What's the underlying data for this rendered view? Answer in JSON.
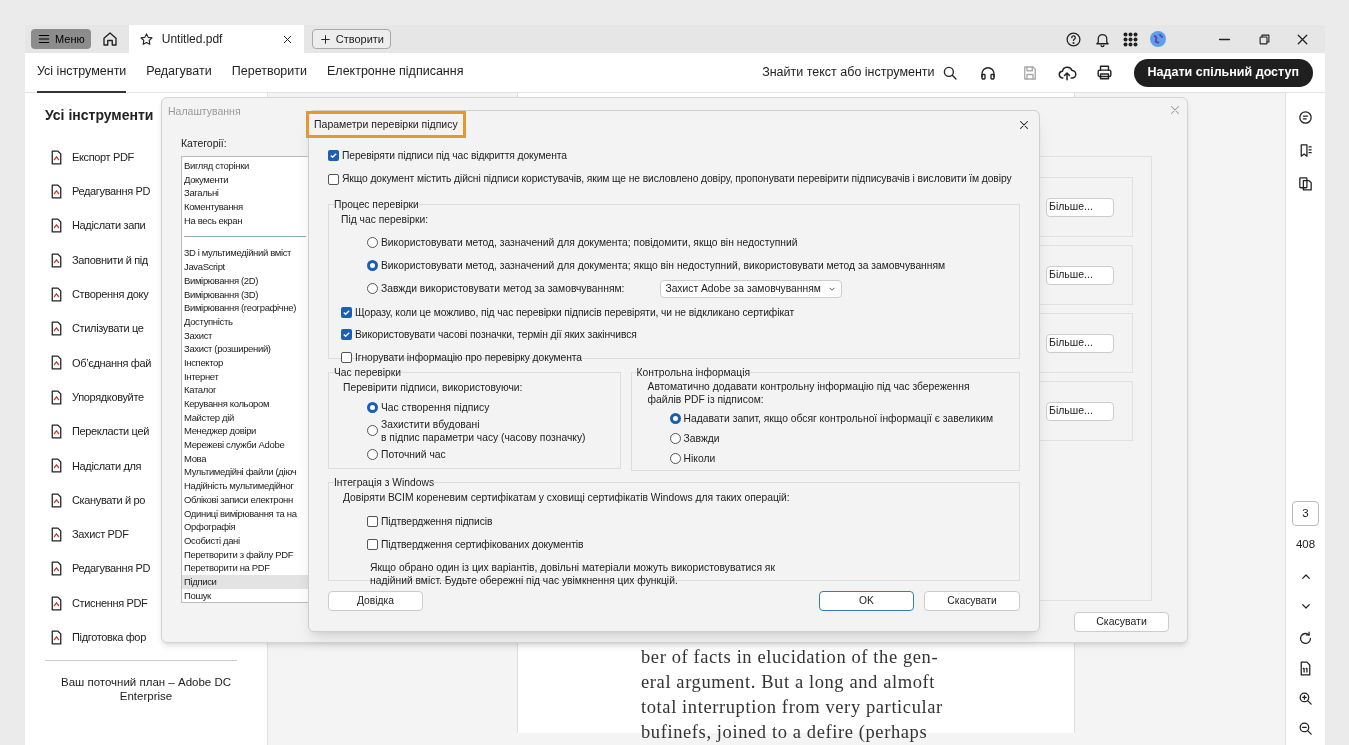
{
  "tab_bar": {
    "menu_button": "Меню",
    "tabs": [
      {
        "label": "Untitled.pdf",
        "selected": true
      }
    ],
    "new_button": "Створити"
  },
  "toolbar": {
    "tabs": [
      {
        "label": "Усі інструменти",
        "selected": true
      },
      {
        "label": "Редагувати",
        "selected": false
      },
      {
        "label": "Перетворити",
        "selected": false
      },
      {
        "label": "Електронне підписання",
        "selected": false
      }
    ],
    "search": "Знайти текст або інструменти",
    "share_button": "Надати спільний доступ"
  },
  "tools_panel": {
    "title": "Усі інструменти",
    "items": [
      "Експорт PDF",
      "Редагування PD",
      "Надіслати запи",
      "Заповнити й під",
      "Створення доку",
      "Стилізувати це",
      "Об’єднання фай",
      "Упорядковуйте",
      "Перекласти цей",
      "Надіслати для",
      "Сканувати й ро",
      "Захист PDF",
      "Редагування PD",
      "Стиснення PDF",
      "Підготовка фор"
    ],
    "plan": "Ваш поточний план – Adobe DC Enterprise"
  },
  "document": {
    "lines": [
      "ber of facts in elucidation of the gen-",
      "eral argument. But a long and almoft",
      "total interruption from very particular",
      "bufinefs, joined to a defire (perhaps"
    ]
  },
  "page_nav": {
    "current": "3",
    "total": "408"
  },
  "preferences_dialog": {
    "title": "Налаштування",
    "categories_label": "Категорії:",
    "category_groups": [
      [
        {
          "label": "Вигляд сторінки",
          "selected": false
        },
        {
          "label": "Документи",
          "selected": false
        },
        {
          "label": "Загальні",
          "selected": false
        },
        {
          "label": "Коментування",
          "selected": false
        },
        {
          "label": "На весь екран",
          "selected": false
        }
      ],
      [
        {
          "label": "3D і мультимедійний вміст",
          "selected": false
        },
        {
          "label": "JavaScript",
          "selected": false
        },
        {
          "label": "Вимірювання (2D)",
          "selected": false
        },
        {
          "label": "Вимірювання (3D)",
          "selected": false
        },
        {
          "label": "Вимірювання (географічне)",
          "selected": false
        },
        {
          "label": "Доступність",
          "selected": false
        },
        {
          "label": "Захист",
          "selected": false
        },
        {
          "label": "Захист (розширений)",
          "selected": false
        },
        {
          "label": "Інспектор",
          "selected": false
        },
        {
          "label": "Інтернет",
          "selected": false
        },
        {
          "label": "Каталог",
          "selected": false
        },
        {
          "label": "Керування кольором",
          "selected": false
        },
        {
          "label": "Майстер дій",
          "selected": false
        },
        {
          "label": "Менеджер довіри",
          "selected": false
        },
        {
          "label": "Мережеві служби Adobe",
          "selected": false
        },
        {
          "label": "Мова",
          "selected": false
        },
        {
          "label": "Мультимедійні файли (діюч",
          "selected": false
        },
        {
          "label": "Надійність мультимедійног",
          "selected": false
        },
        {
          "label": "Облікові записи електронн",
          "selected": false
        },
        {
          "label": "Одиниці вимірювання та на",
          "selected": false
        },
        {
          "label": "Орфографія",
          "selected": false
        },
        {
          "label": "Особисті дані",
          "selected": false
        },
        {
          "label": "Перетворити з файлу PDF",
          "selected": false
        },
        {
          "label": "Перетворити на PDF",
          "selected": false
        },
        {
          "label": "Підписи",
          "selected": true
        },
        {
          "label": "Пошук",
          "selected": false
        }
      ]
    ],
    "more_buttons": [
      "Більше...",
      "Більше...",
      "Більше...",
      "Більше..."
    ],
    "cancel_button": "Скасувати"
  },
  "signature_dialog": {
    "title": "Параметри перевірки підпису",
    "title_highlighted": true,
    "options": [
      {
        "label": "Перевіряти підписи під час відкриття документа",
        "checked": true
      },
      {
        "label": "Якщо документ містить дійсні підписи користувачів, яким ще не висловлено довіру, пропонувати перевірити підписувачів і висловити їм довіру",
        "checked": false
      }
    ],
    "verification_process": {
      "title": "Процес перевірки",
      "prompt": "Під час перевірки:",
      "methods": [
        {
          "label": "Використовувати метод, зазначений для документа; повідомити, якщо він недоступний",
          "selected": false
        },
        {
          "label": "Використовувати метод, зазначений для документа; якщо він недоступний, використовувати метод за замовчуванням",
          "selected": true
        },
        {
          "label": "Завжди використовувати метод за замовчуванням:",
          "selected": false,
          "dropdown": "Захист Adobe за замовчуванням"
        }
      ],
      "options": [
        {
          "label": "Щоразу, коли це можливо, під час перевірки підписів перевіряти, чи не відкликано сертифікат",
          "checked": true
        },
        {
          "label": "Використовувати часові позначки, термін дії яких закінчився",
          "checked": true
        },
        {
          "label": "Ігнорувати інформацію про перевірку документа",
          "checked": false
        }
      ]
    },
    "verification_time": {
      "title": "Час перевірки",
      "prompt": "Перевірити підписи, використовуючи:",
      "choices": [
        {
          "label": "Час створення підпису",
          "selected": true
        },
        {
          "label": "Захистити вбудовані\nв підпис параметри часу (часову позначку)",
          "selected": false
        },
        {
          "label": "Поточний час",
          "selected": false
        }
      ]
    },
    "revocation_info": {
      "title": "Контрольна інформація",
      "prompt": "Автоматично додавати контрольну інформацію під час збереження файлів PDF із підписом:",
      "choices": [
        {
          "label": "Надавати запит, якщо обсяг контрольної інформації є завеликим",
          "selected": true
        },
        {
          "label": "Завжди",
          "selected": false
        },
        {
          "label": "Ніколи",
          "selected": false
        }
      ]
    },
    "windows_integration": {
      "title": "Інтеграція з Windows",
      "prompt": "Довіряти ВСІМ кореневим сертифікатам у сховищі сертифікатів Windows для таких операцій:",
      "options": [
        {
          "label": "Підтвердження підписів",
          "checked": false
        },
        {
          "label": "Підтвердження сертифікованих документів",
          "checked": false
        }
      ],
      "note": "Якщо обрано один із цих варіантів, довільні матеріали можуть використовуватися як\nнадійний вміст. Будьте обережні під час увімкнення цих функцій."
    },
    "help_button": "Довідка",
    "ok_button": "OK",
    "cancel_button": "Скасувати"
  }
}
